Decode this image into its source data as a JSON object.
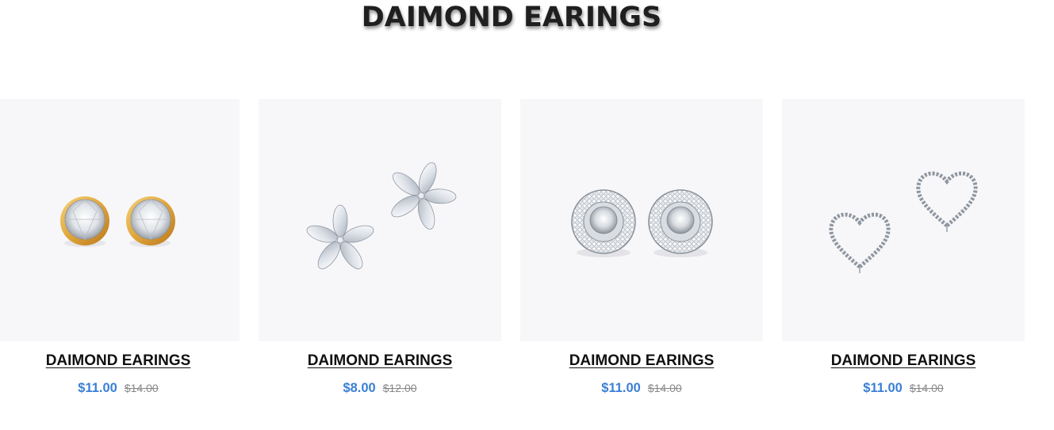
{
  "section": {
    "title": "DAIMOND EARINGS"
  },
  "products": [
    {
      "title": "DAIMOND EARINGS",
      "price": "$11.00",
      "old_price": "$14.00",
      "image_icon": "gold-bezel-diamond-stud-earrings-image"
    },
    {
      "title": "DAIMOND EARINGS",
      "price": "$8.00",
      "old_price": "$12.00",
      "image_icon": "flower-diamond-earrings-image"
    },
    {
      "title": "DAIMOND EARINGS",
      "price": "$11.00",
      "old_price": "$14.00",
      "image_icon": "halo-diamond-stud-earrings-image"
    },
    {
      "title": "DAIMOND EARINGS",
      "price": "$11.00",
      "old_price": "$14.00",
      "image_icon": "heart-diamond-earrings-image"
    }
  ],
  "colors": {
    "title": "#1f1f1f",
    "product_title": "#111111",
    "price": "#3a7fd5",
    "old_price": "#888888",
    "image_bg": "#f7f7f9",
    "gold": "#e0a53a",
    "silver": "#c9ccd1"
  }
}
